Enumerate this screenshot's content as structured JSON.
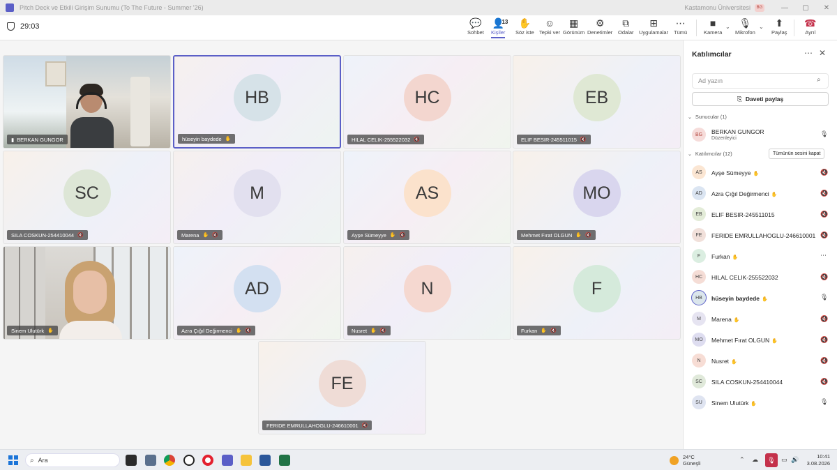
{
  "window": {
    "title": "Pitch Deck ve Etkili Girişim Sunumu (To The Future - Summer '26)",
    "org": "Kastamonu Üniversitesi",
    "org_badge": "BG",
    "minimize": "—",
    "maximize": "▢",
    "close": "✕"
  },
  "toolbar": {
    "timer": "29:03",
    "people_count": "13",
    "items": [
      {
        "label": "Sohbet",
        "icon": "chat-icon"
      },
      {
        "label": "Kişiler",
        "icon": "people-icon"
      },
      {
        "label": "Söz iste",
        "icon": "raise-hand-icon"
      },
      {
        "label": "Tepki ver",
        "icon": "react-icon"
      },
      {
        "label": "Görünüm",
        "icon": "view-icon"
      },
      {
        "label": "Denetimler",
        "icon": "controls-icon"
      },
      {
        "label": "Odalar",
        "icon": "rooms-icon"
      },
      {
        "label": "Uygulamalar",
        "icon": "apps-icon"
      },
      {
        "label": "Tümü",
        "icon": "more-icon"
      },
      {
        "label": "Kamera",
        "icon": "camera-icon"
      },
      {
        "label": "Mikrofon",
        "icon": "microphone-icon"
      },
      {
        "label": "Paylaş",
        "icon": "share-screen-icon"
      },
      {
        "label": "Ayrıl",
        "icon": "leave-phone-icon"
      }
    ]
  },
  "tiles": [
    {
      "name": "BERKAN GUNGOR",
      "initials": "",
      "video": true,
      "hand": false,
      "muted": false
    },
    {
      "name": "hüseyin baydede",
      "initials": "HB",
      "hand": true,
      "muted": false,
      "selected": true,
      "color": "#d6e2e8"
    },
    {
      "name": "HILAL CELIK-255522032",
      "initials": "HC",
      "hand": false,
      "muted": true,
      "color": "#f3d6cf"
    },
    {
      "name": "ELIF BESIR-245511015",
      "initials": "EB",
      "hand": false,
      "muted": true,
      "color": "#dfe8d4"
    },
    {
      "name": "SILA COSKUN-254410044",
      "initials": "SC",
      "hand": false,
      "muted": true,
      "color": "#dde6d6"
    },
    {
      "name": "Marena",
      "initials": "M",
      "hand": true,
      "muted": true,
      "color": "#e2e0ef"
    },
    {
      "name": "Ayşe Sümeyye",
      "initials": "AS",
      "hand": true,
      "muted": true,
      "color": "#fbe2cc"
    },
    {
      "name": "Mehmet Fırat OLGUN",
      "initials": "MO",
      "hand": true,
      "muted": true,
      "color": "#d9d6ee"
    },
    {
      "name": "Sinem Ulutürk",
      "initials": "",
      "video": true,
      "hand": true,
      "muted": false
    },
    {
      "name": "Azra Çığıl Değirmenci",
      "initials": "AD",
      "hand": true,
      "muted": true,
      "color": "#d3e0f1"
    },
    {
      "name": "Nusret",
      "initials": "N",
      "hand": true,
      "muted": true,
      "color": "#f5d8d0"
    },
    {
      "name": "Furkan",
      "initials": "F",
      "hand": true,
      "muted": true,
      "color": "#d5eadb"
    },
    {
      "name": "FERIDE EMRULLAHOGLU-246610001",
      "initials": "FE",
      "hand": false,
      "muted": true,
      "color": "#efdcd6"
    }
  ],
  "panel": {
    "title": "Katılımcılar",
    "more": "⋯",
    "close": "✕",
    "search_placeholder": "Ad yazın",
    "share_invite": "Daveti paylaş",
    "presenters_label": "Sunucular (1)",
    "attendees_label": "Katılımcılar (12)",
    "mute_all": "Tümünün sesini kapat",
    "presenters": [
      {
        "initials": "BG",
        "name": "BERKAN GUNGOR",
        "role": "Düzenleyici",
        "color": "#f6dcda",
        "text": "#b3433b"
      }
    ],
    "attendees": [
      {
        "initials": "AS",
        "name": "Ayşe Sümeyye",
        "hand": true,
        "status": "muted",
        "color": "#fbe6d3"
      },
      {
        "initials": "AD",
        "name": "Azra Çığıl Değirmenci",
        "hand": true,
        "status": "muted",
        "color": "#dbe5f2"
      },
      {
        "initials": "EB",
        "name": "ELIF BESIR-245511015",
        "hand": false,
        "status": "muted",
        "color": "#e3ecd8"
      },
      {
        "initials": "FE",
        "name": "FERIDE EMRULLAHOGLU-246610001",
        "hand": false,
        "status": "muted",
        "color": "#f1e0da"
      },
      {
        "initials": "F",
        "name": "Furkan",
        "hand": true,
        "status": "more",
        "color": "#dbeee1"
      },
      {
        "initials": "HC",
        "name": "HILAL CELIK-255522032",
        "hand": false,
        "status": "muted",
        "color": "#f5ddd6"
      },
      {
        "initials": "HB",
        "name": "hüseyin baydede",
        "hand": true,
        "status": "mic",
        "color": "#dbe6ec",
        "bold": true
      },
      {
        "initials": "M",
        "name": "Marena",
        "hand": true,
        "status": "muted",
        "color": "#e6e4f1"
      },
      {
        "initials": "MO",
        "name": "Mehmet Fırat OLGUN",
        "hand": true,
        "status": "muted",
        "color": "#deddf0"
      },
      {
        "initials": "N",
        "name": "Nusret",
        "hand": true,
        "status": "muted",
        "color": "#f7ddd5"
      },
      {
        "initials": "SC",
        "name": "SILA COSKUN-254410044",
        "hand": false,
        "status": "muted",
        "color": "#e0e9da"
      },
      {
        "initials": "SU",
        "name": "Sinem Ulutürk",
        "hand": true,
        "status": "mic",
        "color": "#dfe4f1"
      }
    ]
  },
  "taskbar": {
    "search_label": "Ara",
    "temperature": "24°C",
    "weather_text": "Güneşli",
    "time": "10:41",
    "date": "3.08.2026"
  },
  "colors": {
    "accent": "#5b5fc7",
    "leave": "#c4314b"
  }
}
